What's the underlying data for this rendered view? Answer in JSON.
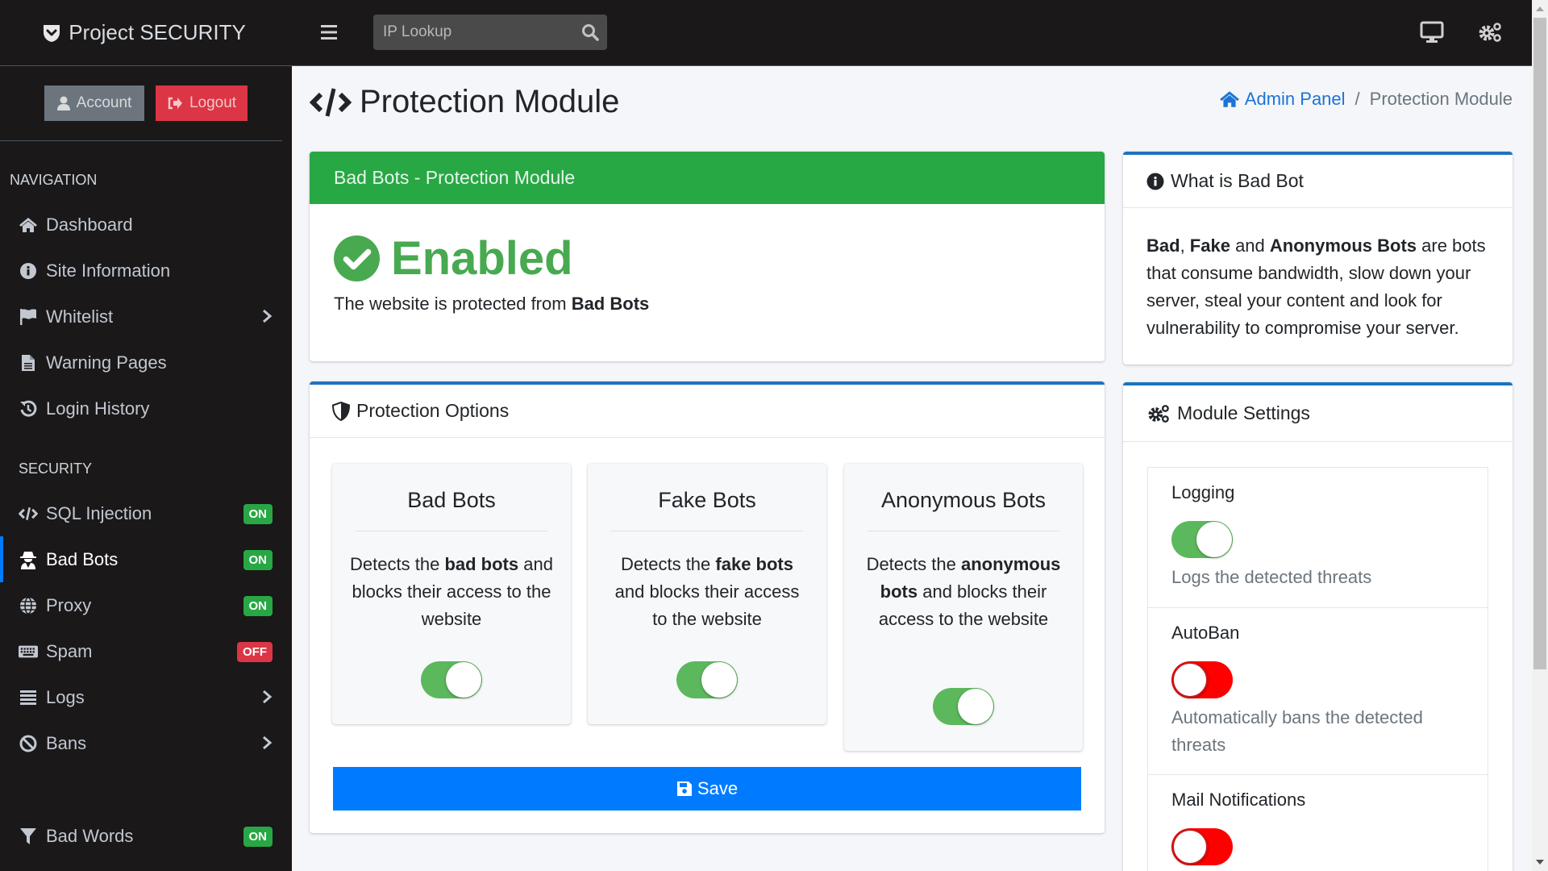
{
  "brand": {
    "name": "Project SECURITY"
  },
  "user_buttons": {
    "account": "Account",
    "logout": "Logout"
  },
  "sidebar": {
    "nav_header": "NAVIGATION",
    "nav_items": [
      {
        "label": "Dashboard",
        "icon": "home-icon"
      },
      {
        "label": "Site Information",
        "icon": "info-circle-icon"
      },
      {
        "label": "Whitelist",
        "icon": "flag-icon",
        "has_submenu": true
      },
      {
        "label": "Warning Pages",
        "icon": "file-icon"
      },
      {
        "label": "Login History",
        "icon": "history-icon"
      }
    ],
    "security_header": "SECURITY",
    "security_items": [
      {
        "label": "SQL Injection",
        "icon": "code-icon",
        "badge": "ON"
      },
      {
        "label": "Bad Bots",
        "icon": "user-secret-icon",
        "badge": "ON",
        "active": true
      },
      {
        "label": "Proxy",
        "icon": "globe-icon",
        "badge": "ON"
      },
      {
        "label": "Spam",
        "icon": "keyboard-icon",
        "badge": "OFF"
      },
      {
        "label": "Logs",
        "icon": "list-icon",
        "has_submenu": true
      },
      {
        "label": "Bans",
        "icon": "ban-icon",
        "has_submenu": true
      }
    ],
    "extra_items": [
      {
        "label": "Bad Words",
        "icon": "filter-icon",
        "badge": "ON"
      }
    ]
  },
  "topbar": {
    "search_placeholder": "IP Lookup",
    "search_value": ""
  },
  "page": {
    "title": "Protection Module",
    "breadcrumb": {
      "home": "Admin Panel",
      "separator": "/",
      "current": "Protection Module"
    }
  },
  "status_card": {
    "header": "Bad Bots - Protection Module",
    "status": "Enabled",
    "text_prefix": "The website is protected from ",
    "text_bold": "Bad Bots"
  },
  "options_card": {
    "header": "Protection Options",
    "options": [
      {
        "title": "Bad Bots",
        "desc_prefix": "Detects the ",
        "desc_bold": "bad bots",
        "desc_suffix": " and blocks their access to the website",
        "enabled": true
      },
      {
        "title": "Fake Bots",
        "desc_prefix": "Detects the ",
        "desc_bold": "fake bots",
        "desc_suffix": " and blocks their access to the website",
        "enabled": true
      },
      {
        "title": "Anonymous Bots",
        "desc_prefix": "Detects the ",
        "desc_bold": "anonymous bots",
        "desc_suffix": " and blocks their access to the website",
        "enabled": true
      }
    ],
    "save_label": "Save"
  },
  "info_card": {
    "header": "What is Bad Bot",
    "b1": "Bad",
    "t1": ", ",
    "b2": "Fake",
    "t2": " and ",
    "b3": "Anonymous Bots",
    "t3": " are bots that consume bandwidth, slow down your server, steal your content and look for vulnerability to compromise your server."
  },
  "settings_card": {
    "header": "Module Settings",
    "settings": [
      {
        "name": "Logging",
        "enabled": true,
        "desc": "Logs the detected threats"
      },
      {
        "name": "AutoBan",
        "enabled": false,
        "desc": "Automatically bans the detected threats"
      },
      {
        "name": "Mail Notifications",
        "enabled": false,
        "desc": ""
      }
    ]
  },
  "colors": {
    "sidebar_bg": "#1a1819",
    "success": "#28a745",
    "danger": "#dc3545",
    "primary": "#007bff",
    "card_outline": "#1e73be",
    "toggle_on": "#5cb85c",
    "toggle_off": "#ff0000"
  }
}
